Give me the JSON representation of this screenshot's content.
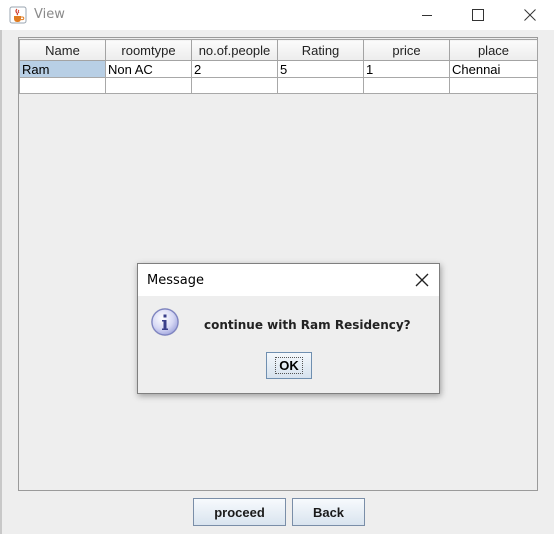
{
  "window": {
    "title": "View",
    "icons": {
      "app": "java-cup-icon",
      "minimize": "minimize-icon",
      "maximize": "maximize-icon",
      "close": "close-icon"
    }
  },
  "table": {
    "headers": [
      "Name",
      "roomtype",
      "no.of.people",
      "Rating",
      "price",
      "place"
    ],
    "rows": [
      [
        "Ram",
        "Non AC",
        "2",
        "5",
        "1",
        "Chennai"
      ]
    ],
    "selected_cell": {
      "row": 0,
      "col": 0
    }
  },
  "dialog": {
    "title": "Message",
    "message": "continue with Ram Residency?",
    "ok_label": "OK",
    "icon": "info-icon"
  },
  "buttons": {
    "proceed": "proceed",
    "back": "Back"
  },
  "colors": {
    "selection": "#b8cfe5",
    "background": "#eeeeee",
    "button_border": "#7a8ea8"
  }
}
